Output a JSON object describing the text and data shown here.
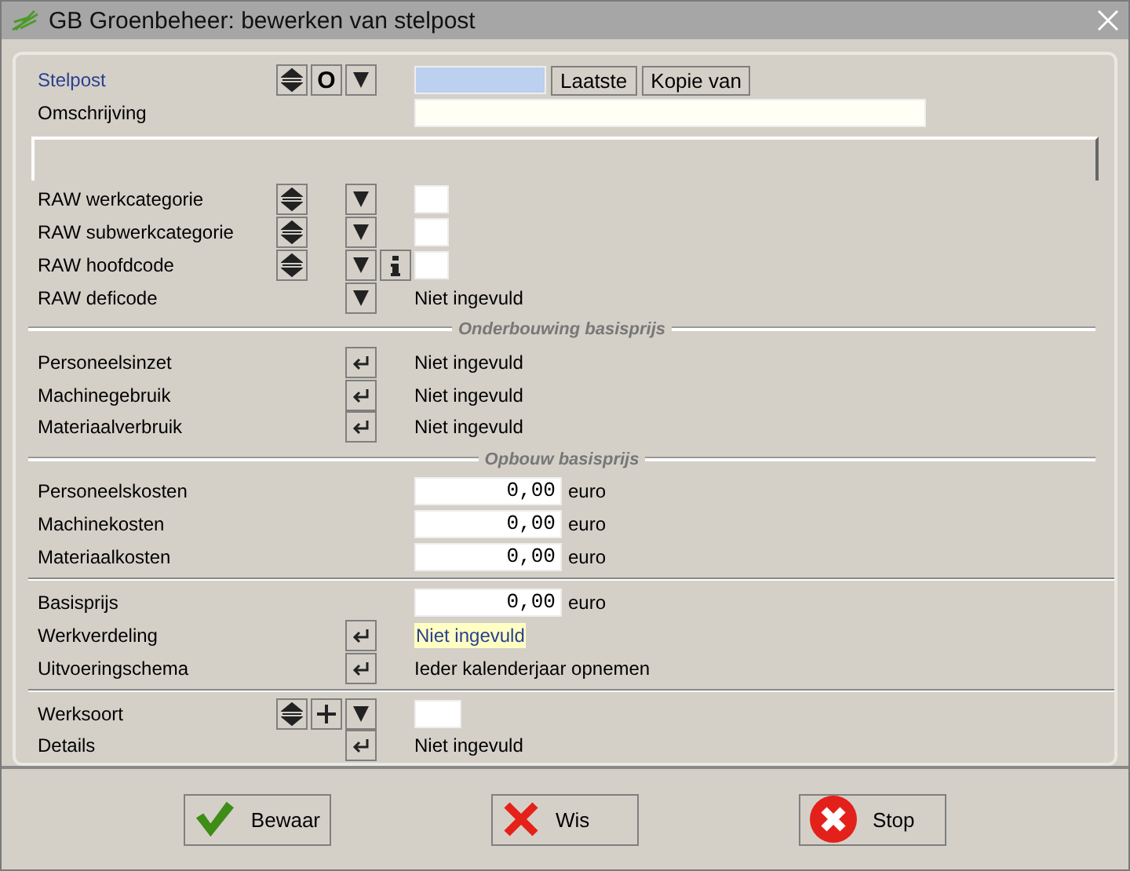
{
  "window": {
    "title": "GB Groenbeheer: bewerken van stelpost"
  },
  "header": {
    "stelpost": {
      "label": "Stelpost",
      "controls": [
        {
          "kind": "updown"
        },
        {
          "kind": "char",
          "text": "O"
        },
        {
          "kind": "dropdown"
        }
      ],
      "buttons": [
        "Laatste",
        "Kopie van"
      ]
    },
    "omschrijving": {
      "label": "Omschrijving"
    }
  },
  "sections": [
    {
      "rows": [
        {
          "label": "RAW werkcategorie",
          "controls": [
            {
              "kind": "updown"
            },
            {
              "kind": "dropdown"
            }
          ],
          "value": {
            "kind": "box"
          }
        },
        {
          "label": "RAW subwerkcategorie",
          "controls": [
            {
              "kind": "updown"
            },
            {
              "kind": "dropdown"
            }
          ],
          "value": {
            "kind": "box"
          }
        },
        {
          "label": "RAW hoofdcode",
          "controls": [
            {
              "kind": "updown"
            },
            {
              "kind": "dropdown"
            },
            {
              "kind": "info"
            }
          ],
          "value": {
            "kind": "box"
          }
        },
        {
          "label": "RAW deficode",
          "controls": [
            {
              "kind": "dropdown"
            }
          ],
          "value": {
            "kind": "text",
            "text": "Niet ingevuld"
          }
        }
      ]
    },
    {
      "title": "Onderbouwing basisprijs",
      "rows": [
        {
          "label": "Personeelsinzet",
          "controls": [
            {
              "kind": "enter"
            }
          ],
          "value": {
            "kind": "text",
            "text": "Niet ingevuld"
          }
        },
        {
          "label": "Machinegebruik",
          "controls": [
            {
              "kind": "enter"
            }
          ],
          "value": {
            "kind": "text",
            "text": "Niet ingevuld"
          }
        },
        {
          "label": "Materiaalverbruik",
          "controls": [
            {
              "kind": "enter"
            }
          ],
          "value": {
            "kind": "text",
            "text": "Niet ingevuld"
          }
        }
      ]
    },
    {
      "title": "Opbouw basisprijs",
      "rows": [
        {
          "label": "Personeelskosten",
          "controls": [],
          "value": {
            "kind": "amount",
            "text": "0,00",
            "unit": "euro"
          }
        },
        {
          "label": "Machinekosten",
          "controls": [],
          "value": {
            "kind": "amount",
            "text": "0,00",
            "unit": "euro"
          }
        },
        {
          "label": "Materiaalkosten",
          "controls": [],
          "value": {
            "kind": "amount",
            "text": "0,00",
            "unit": "euro"
          }
        }
      ]
    },
    {
      "rows": [
        {
          "label": "Basisprijs",
          "controls": [],
          "value": {
            "kind": "amount",
            "text": "0,00",
            "unit": "euro"
          }
        },
        {
          "label": "Werkverdeling",
          "controls": [
            {
              "kind": "enter"
            }
          ],
          "value": {
            "kind": "highlight",
            "text": "Niet ingevuld"
          }
        },
        {
          "label": "Uitvoeringschema",
          "controls": [
            {
              "kind": "enter"
            }
          ],
          "value": {
            "kind": "text",
            "text": "Ieder kalenderjaar opnemen"
          }
        }
      ]
    },
    {
      "rows": [
        {
          "label": "Werksoort",
          "controls": [
            {
              "kind": "updown"
            },
            {
              "kind": "plus"
            },
            {
              "kind": "dropdown"
            }
          ],
          "value": {
            "kind": "wide-box"
          }
        },
        {
          "label": "Details",
          "controls": [
            {
              "kind": "enter"
            }
          ],
          "value": {
            "kind": "text",
            "text": "Niet ingevuld"
          }
        }
      ]
    }
  ],
  "footer": [
    {
      "kind": "save",
      "label": "Bewaar"
    },
    {
      "kind": "clear",
      "label": "Wis"
    },
    {
      "kind": "stop",
      "label": "Stop"
    }
  ]
}
